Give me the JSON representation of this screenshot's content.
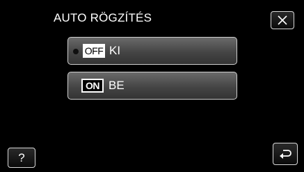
{
  "header": {
    "title": "AUTO RÖGZÍTÉS"
  },
  "options": [
    {
      "badge": "OFF",
      "label": "KI",
      "selected": true
    },
    {
      "badge": "ON",
      "label": "BE",
      "selected": false
    }
  ],
  "buttons": {
    "close_icon": "close-icon",
    "help_label": "?",
    "back_icon": "return-arrow-icon"
  }
}
